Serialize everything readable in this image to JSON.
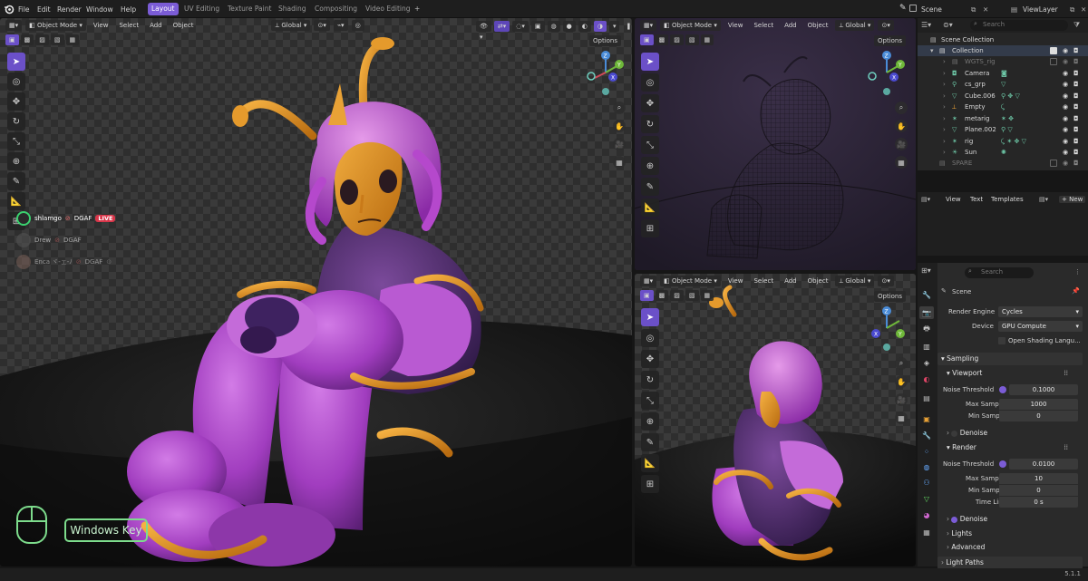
{
  "menu": {
    "file": "File",
    "edit": "Edit",
    "render": "Render",
    "window": "Window",
    "help": "Help"
  },
  "workspaces": [
    {
      "label": "Layout",
      "active": true
    },
    {
      "label": "UV Editing",
      "active": false
    },
    {
      "label": "Texture Paint",
      "active": false
    },
    {
      "label": "Shading",
      "active": false
    },
    {
      "label": "Compositing",
      "active": false
    },
    {
      "label": "Video Editing",
      "active": false
    }
  ],
  "add_workspace": "+",
  "scene": {
    "name": "Scene",
    "view_layer": "ViewLayer"
  },
  "viewport_header": {
    "mode": "Object Mode",
    "view": "View",
    "select": "Select",
    "add": "Add",
    "object": "Object",
    "orientation": "Global",
    "options": "Options"
  },
  "stream_overlay": {
    "users": [
      {
        "name": "shlamgo",
        "tag": "DGAF",
        "badge": "LIVE"
      },
      {
        "name": "Drew",
        "tag": "DGAF"
      },
      {
        "name": "Enca ヾ-ェ-ﾉ",
        "tag": "DGAF"
      }
    ]
  },
  "key_overlay": {
    "label": "Windows Key"
  },
  "outliner": {
    "search_placeholder": "Search",
    "root": "Scene Collection",
    "collection": "Collection",
    "items": [
      {
        "name": "WGTS_rig",
        "dim": true
      },
      {
        "name": "Camera",
        "dim": false
      },
      {
        "name": "cs_grp",
        "dim": false
      },
      {
        "name": "Cube.006",
        "dim": false
      },
      {
        "name": "Empty",
        "dim": false
      },
      {
        "name": "metarig",
        "dim": false
      },
      {
        "name": "Plane.002",
        "dim": false
      },
      {
        "name": "rig",
        "dim": false
      },
      {
        "name": "Sun",
        "dim": false
      }
    ],
    "spare": "SPARE"
  },
  "text_editor": {
    "view": "View",
    "text": "Text",
    "templates": "Templates",
    "new": "New"
  },
  "properties": {
    "search_placeholder": "Search",
    "scene_label": "Scene",
    "render_engine_label": "Render Engine",
    "render_engine": "Cycles",
    "device_label": "Device",
    "device": "GPU Compute",
    "osl_label": "Open Shading Langu...",
    "sampling": "Sampling",
    "viewport": "Viewport",
    "vp_noise_label": "Noise Threshold",
    "vp_noise": "0.1000",
    "vp_max_label": "Max Samples",
    "vp_max": "1000",
    "vp_min_label": "Min Samples",
    "vp_min": "0",
    "denoise": "Denoise",
    "render": "Render",
    "r_noise_label": "Noise Threshold",
    "r_noise": "0.0100",
    "r_max_label": "Max Samples",
    "r_max": "10",
    "r_min_label": "Min Samples",
    "r_min": "0",
    "time_limit_label": "Time Limit",
    "time_limit": "0 s",
    "denoise2": "Denoise",
    "lights": "Lights",
    "advanced": "Advanced",
    "light_paths": "Light Paths"
  },
  "version": "5.1.1",
  "colors": {
    "accent": "#7b5cd6",
    "tool_selected": "#6b50c8",
    "live": "#d9364a",
    "overlay_green": "#7ddc8c"
  }
}
